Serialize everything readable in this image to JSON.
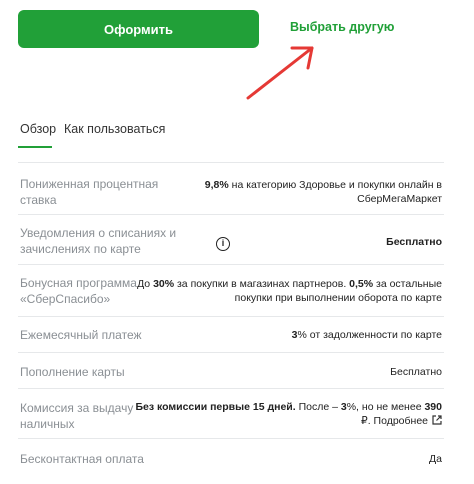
{
  "actions": {
    "primary_label": "Оформить",
    "secondary_label": "Выбрать другую"
  },
  "tabs": [
    {
      "label": "Обзор",
      "active": true
    },
    {
      "label": "Как пользоваться",
      "active": false
    }
  ],
  "features": {
    "rate": {
      "label_l1": "Пониженная процентная",
      "label_l2": "ставка",
      "value_bold": "9,8%",
      "value_l1_rest": " на категорию Здоровье и покупки онлайн в",
      "value_l2": "СберМегаМаркет"
    },
    "notifications": {
      "label_l1": "Уведомления о списаниях и",
      "label_l2": "зачислениях по карте",
      "value": "Бесплатно",
      "icon": "info-icon"
    },
    "bonus": {
      "label_l1": "Бонусная программа",
      "label_l2": "«СберСпасибо»",
      "v1_pre": "До ",
      "v1_bold1": "30%",
      "v1_mid": " за покупки в магазинах партнеров. ",
      "v1_bold2": "0,5%",
      "v1_post": " за остальные",
      "value_l2": "покупки при выполнении оборота по карте"
    },
    "monthly": {
      "label": "Ежемесячный платеж",
      "value_bold": "3",
      "value_rest": "% от задолженности по карте"
    },
    "topup": {
      "label": "Пополнение карты",
      "value": "Бесплатно"
    },
    "cash": {
      "label_l1": "Комиссия за выдачу",
      "label_l2": "наличных",
      "v1_bold1": "Без комиссии первые 15 дней.",
      "v1_mid": " После – ",
      "v1_bold2": "3",
      "v1_mid2": "%, но не менее ",
      "v1_bold3": "390",
      "value_l2": "₽. Подробнее",
      "icon": "external-link-icon"
    },
    "contactless": {
      "label": "Бесконтактная оплата",
      "value": "Да"
    }
  },
  "colors": {
    "accent": "#21a038",
    "arrow": "#e53935",
    "label_gray": "#8a8f94",
    "divider": "#e6e8ea"
  }
}
